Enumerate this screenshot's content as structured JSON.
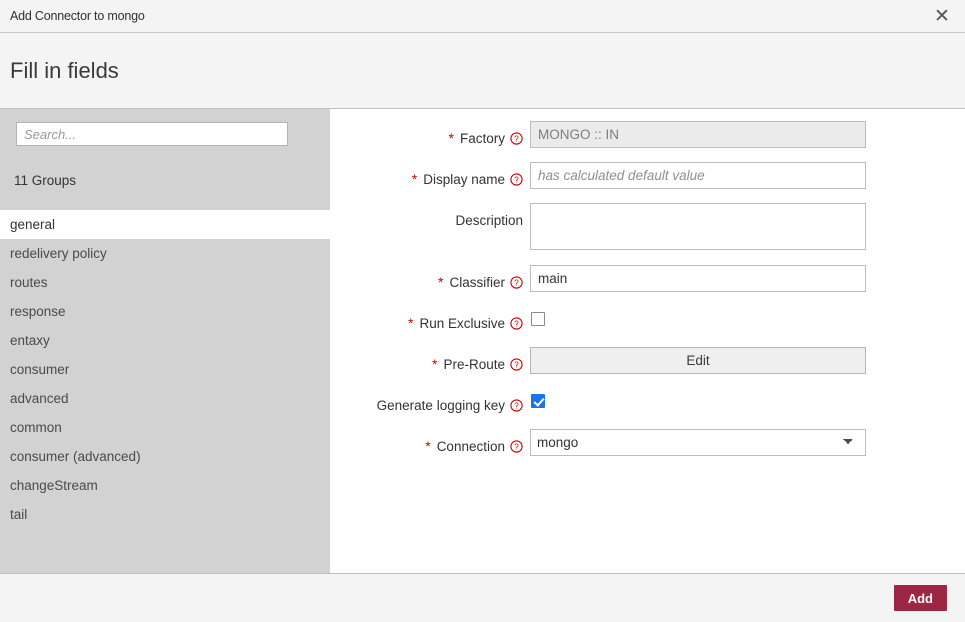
{
  "titlebar": {
    "title": "Add Connector to mongo",
    "close_label": "✕"
  },
  "header": {
    "title": "Fill in fields"
  },
  "sidebar": {
    "search_placeholder": "Search...",
    "search_value": "",
    "groups_count_label": "11 Groups",
    "items": [
      {
        "label": "general",
        "selected": true
      },
      {
        "label": "redelivery policy",
        "selected": false
      },
      {
        "label": "routes",
        "selected": false
      },
      {
        "label": "response",
        "selected": false
      },
      {
        "label": "entaxy",
        "selected": false
      },
      {
        "label": "consumer",
        "selected": false
      },
      {
        "label": "advanced",
        "selected": false
      },
      {
        "label": "common",
        "selected": false
      },
      {
        "label": "consumer (advanced)",
        "selected": false
      },
      {
        "label": "changeStream",
        "selected": false
      },
      {
        "label": "tail",
        "selected": false
      }
    ]
  },
  "form": {
    "required_marker": "*",
    "fields": {
      "factory": {
        "label": "Factory",
        "value": "MONGO :: IN",
        "placeholder": ""
      },
      "display_name": {
        "label": "Display name",
        "value": "",
        "placeholder": "has calculated default value"
      },
      "description": {
        "label": "Description",
        "value": "",
        "placeholder": ""
      },
      "classifier": {
        "label": "Classifier",
        "value": "main",
        "placeholder": ""
      },
      "run_exclusive": {
        "label": "Run Exclusive",
        "checked": false
      },
      "pre_route": {
        "label": "Pre-Route",
        "button_label": "Edit"
      },
      "generate_logging_key": {
        "label": "Generate logging key",
        "checked": true
      },
      "connection": {
        "label": "Connection",
        "value": "mongo",
        "options": [
          "mongo"
        ]
      }
    }
  },
  "footer": {
    "add_label": "Add"
  },
  "colors": {
    "accent_button": "#9c2743",
    "required_marker": "#cc0000",
    "help_icon": "#cc0000",
    "checkbox_checked": "#1a73e8",
    "sidebar_bg": "#d2d2d2",
    "chrome_bg": "#f4f4f4"
  }
}
